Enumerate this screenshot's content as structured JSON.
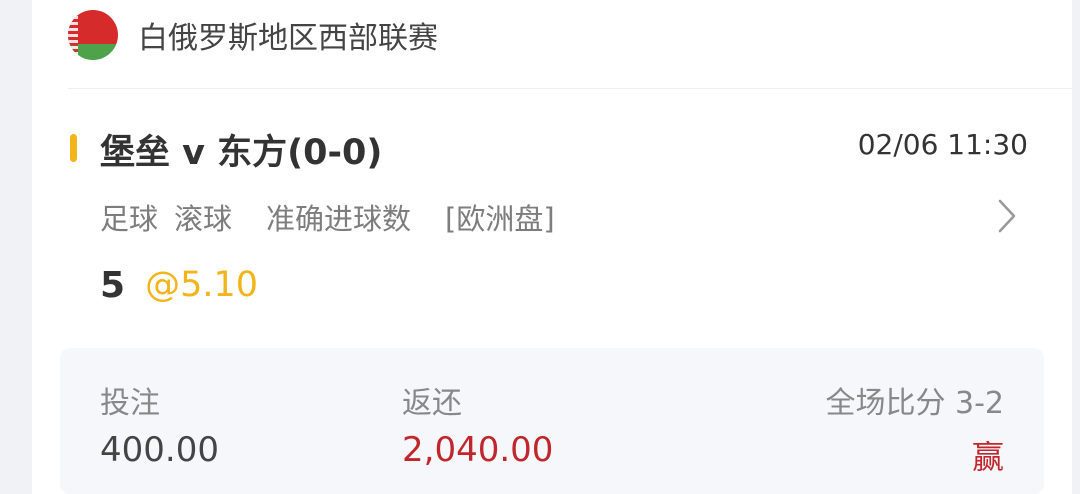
{
  "league": {
    "flag_icon": "belarus-flag-icon",
    "name": "白俄罗斯地区西部联赛"
  },
  "match": {
    "title": "堡垒 v 东方(0-0)",
    "time": "02/06 11:30",
    "accent_color": "#f3b41b"
  },
  "market": {
    "sport": "足球",
    "mode": "滚球",
    "type": "准确进球数",
    "odds_format": "[欧洲盘]",
    "chevron_icon": "chevron-right-icon"
  },
  "selection": {
    "pick": "5",
    "odds": "@5.10",
    "odds_color": "#f3b41b"
  },
  "summary": {
    "stake_label": "投注",
    "stake_value": "400.00",
    "return_label": "返还",
    "return_value": "2,040.00",
    "result_label": "全场比分 3-2",
    "result": "赢",
    "result_color": "#c0272d"
  }
}
